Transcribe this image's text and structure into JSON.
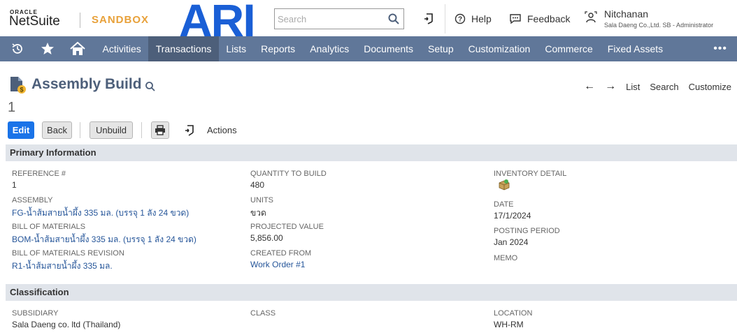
{
  "header": {
    "oracle": "ORACLE",
    "netsuite": "NetSuite",
    "sandbox": "SANDBOX",
    "ari_logo_text": "ARI",
    "search_placeholder": "Search",
    "help": "Help",
    "feedback": "Feedback",
    "user_name": "Nitchanan",
    "user_role": "Sala Daeng Co.,Ltd. SB - Administrator"
  },
  "nav": {
    "items": [
      "Activities",
      "Transactions",
      "Lists",
      "Reports",
      "Analytics",
      "Documents",
      "Setup",
      "Customization",
      "Commerce",
      "Fixed Assets"
    ],
    "active": "Transactions",
    "more": "•••"
  },
  "page": {
    "title": "Assembly Build",
    "record_number": "1",
    "links": {
      "list": "List",
      "search": "Search",
      "customize": "Customize"
    }
  },
  "buttons": {
    "edit": "Edit",
    "back": "Back",
    "unbuild": "Unbuild",
    "actions": "Actions"
  },
  "primary": {
    "header": "Primary Information",
    "reference_label": "REFERENCE #",
    "reference_value": "1",
    "assembly_label": "ASSEMBLY",
    "assembly_value": "FG-น้ำส้มสายน้ำผึ้ง 335 มล. (บรรจุ 1 ลัง 24 ขวด)",
    "bom_label": "BILL OF MATERIALS",
    "bom_value": "BOM-น้ำส้มสายน้ำผึ้ง 335 มล. (บรรจุ 1 ลัง 24 ขวด)",
    "bom_rev_label": "BILL OF MATERIALS REVISION",
    "bom_rev_value": "R1-น้ำส้มสายน้ำผึ้ง 335 มล.",
    "qty_label": "QUANTITY TO BUILD",
    "qty_value": "480",
    "units_label": "UNITS",
    "units_value": "ขวด",
    "projected_label": "PROJECTED VALUE",
    "projected_value": "5,856.00",
    "created_label": "CREATED FROM",
    "created_value": "Work Order #1",
    "inventory_label": "INVENTORY DETAIL",
    "date_label": "DATE",
    "date_value": "17/1/2024",
    "period_label": "POSTING PERIOD",
    "period_value": "Jan 2024",
    "memo_label": "MEMO"
  },
  "classification": {
    "header": "Classification",
    "subsidiary_label": "SUBSIDIARY",
    "subsidiary_value": "Sala Daeng co. ltd (Thailand)",
    "class_label": "CLASS",
    "location_label": "LOCATION",
    "location_value": "WH-RM"
  },
  "colors": {
    "nav_bg": "#607799",
    "nav_active": "#4d5f7a",
    "edit_button": "#1a73e8",
    "link": "#255599",
    "sandbox": "#e8a13a",
    "ari_blue": "#1a5fd6"
  },
  "icons": [
    "search-icon",
    "recent-records-icon",
    "help-icon",
    "feedback-icon",
    "user-role-icon",
    "history-icon",
    "star-icon",
    "home-icon",
    "print-icon",
    "inventory-detail-icon"
  ]
}
